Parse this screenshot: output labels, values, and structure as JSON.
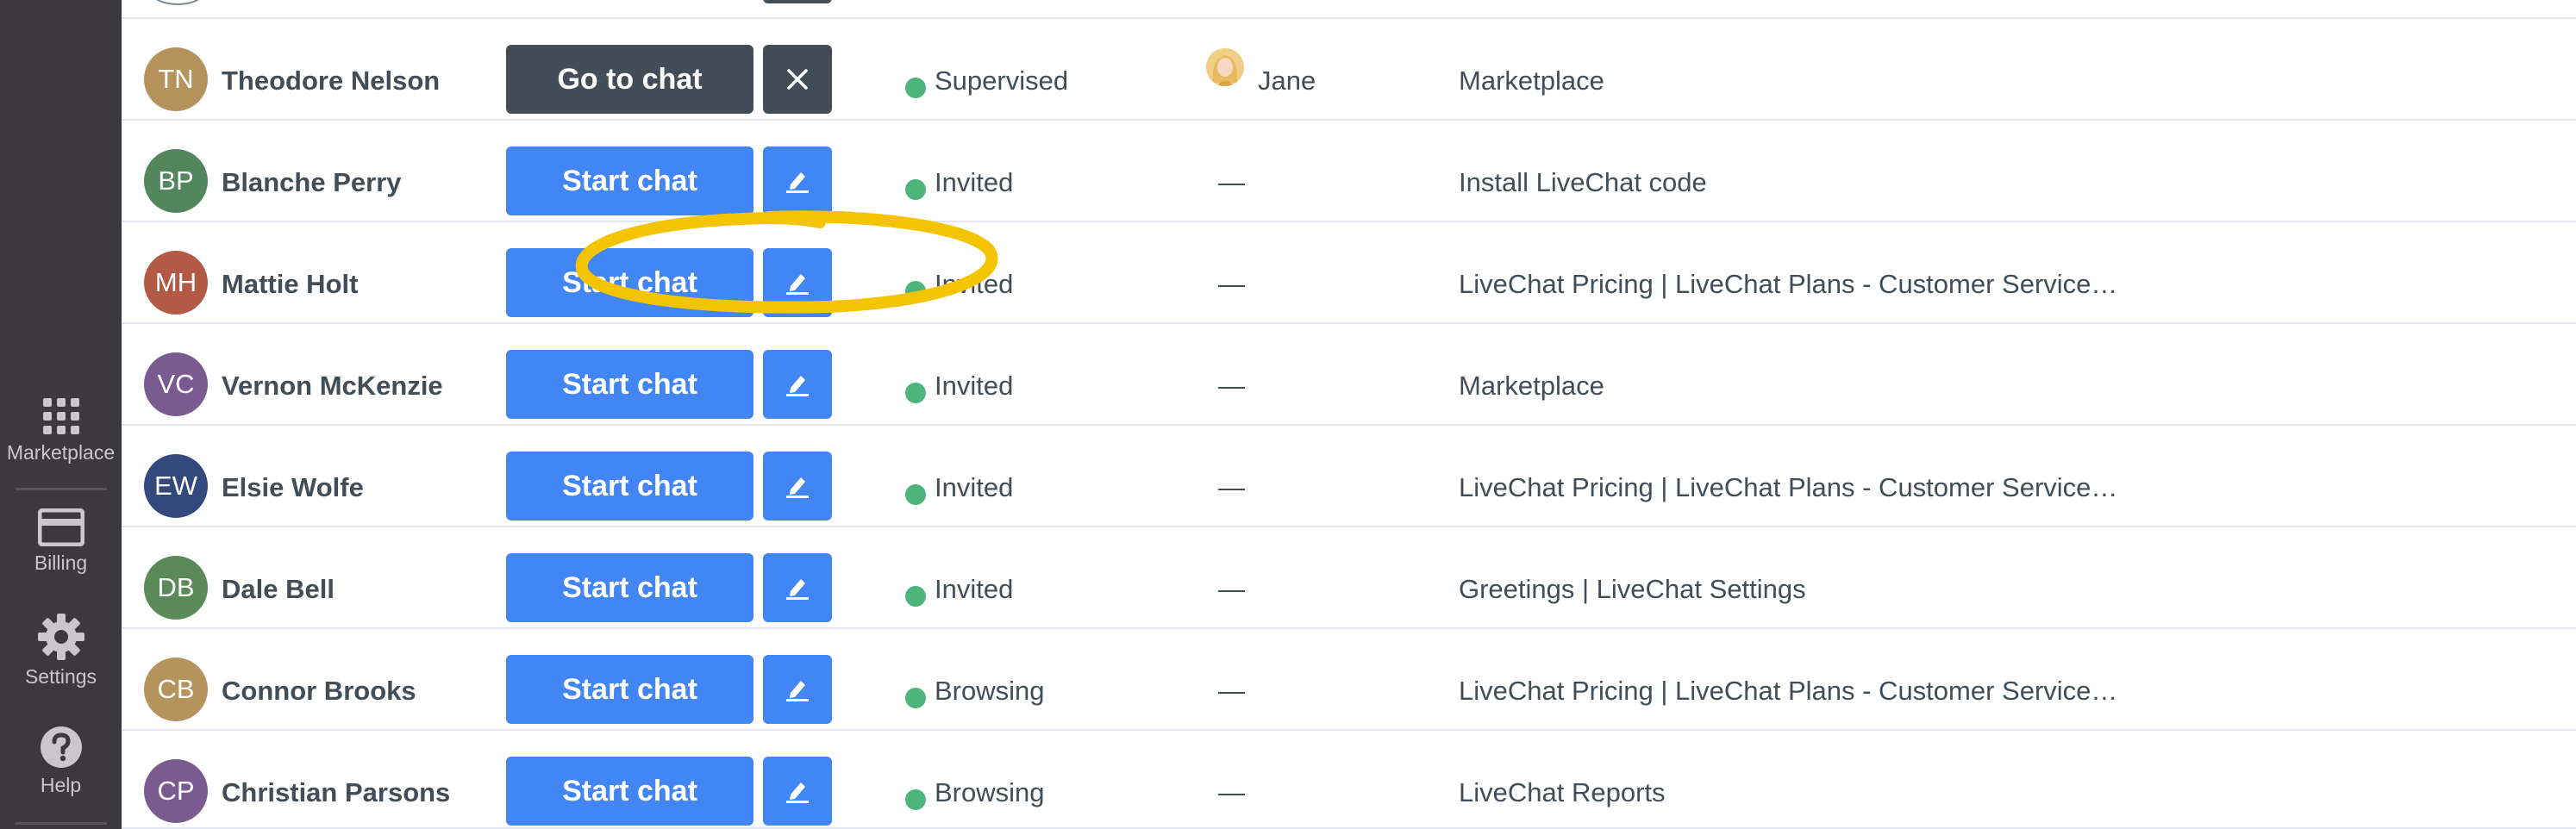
{
  "sidebar": {
    "items": [
      {
        "label": "Marketplace",
        "icon": "grid-icon"
      },
      {
        "label": "Billing",
        "icon": "credit-card-icon"
      },
      {
        "label": "Settings",
        "icon": "gear-icon"
      },
      {
        "label": "Help",
        "icon": "help-icon"
      }
    ]
  },
  "colors": {
    "sidebar_bg": "#3b383e",
    "primary_button": "#4285f4",
    "dark_button": "#424d57",
    "status_green": "#4cb67a",
    "highlight": "#f5c400"
  },
  "rows": [
    {
      "initials": "TN",
      "name": "Theodore Nelson",
      "avatar_color": "#b5935d",
      "action": "Go to chat",
      "action_style": "dark",
      "side_icon": "close-icon",
      "status": "Supervised",
      "agent": "Jane",
      "page": "Marketplace"
    },
    {
      "initials": "BP",
      "name": "Blanche Perry",
      "avatar_color": "#54865e",
      "action": "Start chat",
      "action_style": "primary",
      "side_icon": "edit-icon",
      "status": "Invited",
      "agent": "—",
      "page": "Install LiveChat code"
    },
    {
      "initials": "MH",
      "name": "Mattie Holt",
      "avatar_color": "#b25a45",
      "action": "Start chat",
      "action_style": "primary",
      "side_icon": "edit-icon",
      "status": "Invited",
      "agent": "—",
      "page": "LiveChat Pricing | LiveChat Plans - Customer Service…"
    },
    {
      "initials": "VC",
      "name": "Vernon McKenzie",
      "avatar_color": "#7a5b8f",
      "action": "Start chat",
      "action_style": "primary",
      "side_icon": "edit-icon",
      "status": "Invited",
      "agent": "—",
      "page": "Marketplace"
    },
    {
      "initials": "EW",
      "name": "Elsie Wolfe",
      "avatar_color": "#33497d",
      "action": "Start chat",
      "action_style": "primary",
      "side_icon": "edit-icon",
      "status": "Invited",
      "agent": "—",
      "page": "LiveChat Pricing | LiveChat Plans - Customer Service…"
    },
    {
      "initials": "DB",
      "name": "Dale Bell",
      "avatar_color": "#5a8a58",
      "action": "Start chat",
      "action_style": "primary",
      "side_icon": "edit-icon",
      "status": "Invited",
      "agent": "—",
      "page": "Greetings | LiveChat Settings"
    },
    {
      "initials": "CB",
      "name": "Connor Brooks",
      "avatar_color": "#b5935d",
      "action": "Start chat",
      "action_style": "primary",
      "side_icon": "edit-icon",
      "status": "Browsing",
      "agent": "—",
      "page": "LiveChat Pricing | LiveChat Plans - Customer Service…"
    },
    {
      "initials": "CP",
      "name": "Christian Parsons",
      "avatar_color": "#7a5b8f",
      "action": "Start chat",
      "action_style": "primary",
      "side_icon": "edit-icon",
      "status": "Browsing",
      "agent": "—",
      "page": "LiveChat Reports"
    }
  ]
}
